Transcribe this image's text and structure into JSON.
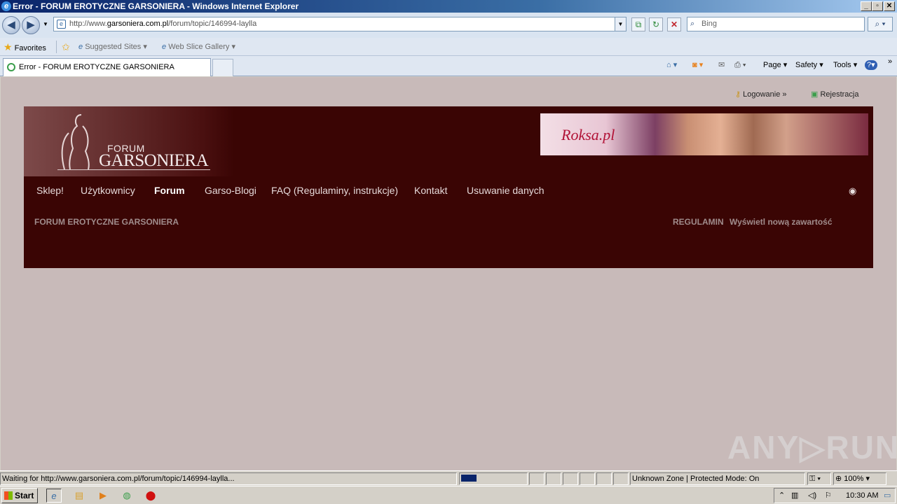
{
  "window": {
    "title": "Error - FORUM EROTYCZNE GARSONIERA - Windows Internet Explorer",
    "min_label": "_",
    "max_label": "▫",
    "close_label": "✕"
  },
  "address": {
    "url_prefix": "http://www.",
    "url_domain": "garsoniera.com.pl",
    "url_path": "/forum/topic/146994-laylla",
    "search_placeholder": "Bing"
  },
  "favorites_bar": {
    "favorites_label": "Favorites",
    "suggested_label": "Suggested Sites ▾",
    "webslice_label": "Web Slice Gallery ▾"
  },
  "tab": {
    "title": "Error - FORUM EROTYCZNE GARSONIERA"
  },
  "command_bar": {
    "page": "Page ▾",
    "safety": "Safety ▾",
    "tools": "Tools ▾",
    "help": "?▾",
    "more": "»"
  },
  "site": {
    "login": "Logowanie »",
    "register": "Rejestracja",
    "logo_top": "FORUM",
    "logo_main": "GARSONIERA",
    "banner_text": "Roksa.pl",
    "nav": [
      "Sklep!",
      "Użytkownicy",
      "Forum",
      "Garso-Blogi",
      "FAQ (Regulaminy, instrukcje)",
      "Kontakt",
      "Usuwanie danych"
    ],
    "breadcrumb": "FORUM EROTYCZNE GARSONIERA",
    "regulamin": "REGULAMIN",
    "new_content": "Wyświetl nową zawartość"
  },
  "watermark": "ANY▷RUN",
  "status_bar": {
    "text": "Waiting for http://www.garsoniera.com.pl/forum/topic/146994-laylla...",
    "zone": "Unknown Zone | Protected Mode: On",
    "zoom": "100%"
  },
  "taskbar": {
    "start": "Start",
    "clock": "10:30 AM"
  },
  "colors": {
    "header_bg": "#3a0504",
    "page_bg": "#c8bab9",
    "titlebar": "#0a246a"
  }
}
